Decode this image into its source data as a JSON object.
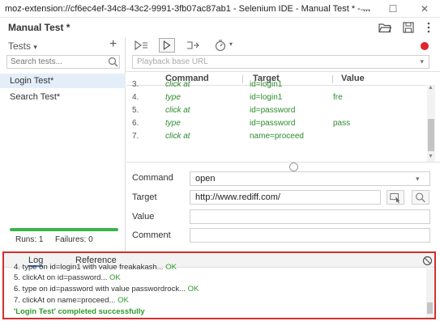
{
  "window": {
    "title": "moz-extension://cf6ec4ef-34c8-43c2-9991-3fb07ac87ab1 - Selenium IDE - Manual Test * - ...",
    "minimize": "—",
    "maximize": "☐",
    "close": "✕"
  },
  "header": {
    "project_name": "Manual Test *",
    "icons": [
      "folder-open-icon",
      "save-icon",
      "more-icon"
    ]
  },
  "sidebar": {
    "tests_label": "Tests",
    "tests_caret": "▾",
    "add_label": "+",
    "search_placeholder": "Search tests...",
    "tests": [
      {
        "name": "Login Test*",
        "active": true
      },
      {
        "name": "Search Test*",
        "active": false
      }
    ],
    "runs_label": "Runs: 1",
    "failures_label": "Failures: 0",
    "progress_fraction": 1.0,
    "progress_color": "#3bb44a"
  },
  "toolbar": {
    "icons": [
      "run-all-icon",
      "run-current-icon",
      "step-over-icon",
      "speed-icon"
    ],
    "speed_caret": "▾",
    "record_color": "#e0242a"
  },
  "playback": {
    "base_url_placeholder": "Playback base URL"
  },
  "command_table": {
    "headers": {
      "command": "Command",
      "target": "Target",
      "value": "Value"
    },
    "rows": [
      {
        "num": "3.",
        "command": "click at",
        "target": "id=login1",
        "value": ""
      },
      {
        "num": "4.",
        "command": "type",
        "target": "id=login1",
        "value": "fre"
      },
      {
        "num": "5.",
        "command": "click at",
        "target": "id=password",
        "value": ""
      },
      {
        "num": "6.",
        "command": "type",
        "target": "id=password",
        "value": "pass"
      },
      {
        "num": "7.",
        "command": "click at",
        "target": "name=proceed",
        "value": ""
      }
    ]
  },
  "editor": {
    "command_label": "Command",
    "command_value": "open",
    "target_label": "Target",
    "target_value": "http://www.rediff.com/",
    "value_label": "Value",
    "value_value": "",
    "comment_label": "Comment",
    "comment_value": ""
  },
  "log": {
    "tabs": [
      "Log",
      "Reference"
    ],
    "lines": [
      {
        "text": "4.  type on id=login1 with value freakakash... ",
        "status": "OK"
      },
      {
        "text": "5.  clickAt on id=password... ",
        "status": "OK"
      },
      {
        "text": "6.  type on id=password with value passwordrock... ",
        "status": "OK"
      },
      {
        "text": "7.  clickAt on name=proceed... ",
        "status": "OK"
      }
    ],
    "success_message": "'Login Test' completed successfully",
    "highlight_color": "#d32f2f"
  }
}
